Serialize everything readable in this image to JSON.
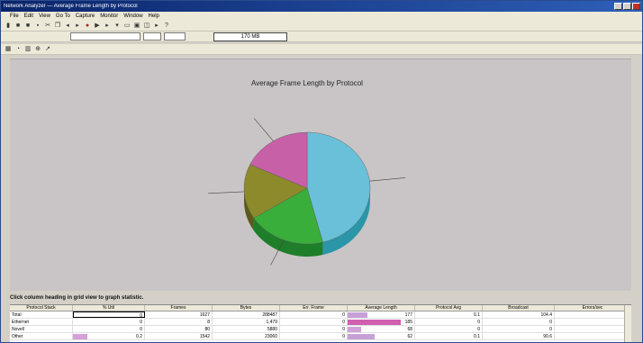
{
  "window": {
    "title": "Network Analyzer — Average Frame Length by Protocol"
  },
  "menu": [
    "File",
    "Edit",
    "View",
    "Go To",
    "Capture",
    "Monitor",
    "Window",
    "Help"
  ],
  "toolbar": {
    "status_value": "170 MB"
  },
  "chart_data": {
    "type": "pie",
    "title": "Average Frame Length by Protocol",
    "series": [
      {
        "name": "",
        "values": [
          46,
          20,
          16,
          18
        ]
      }
    ],
    "slices": [
      {
        "label": "",
        "value": 46,
        "color": "#6ac0d8",
        "side": "#2a96a8"
      },
      {
        "label": "",
        "value": 20,
        "color": "#3aae3a",
        "side": "#1e7e2a"
      },
      {
        "label": "",
        "value": 16,
        "color": "#8c8a2a",
        "side": "#5a5a1a"
      },
      {
        "label": "",
        "value": 18,
        "color": "#c860a8",
        "side": "#8c3c78"
      }
    ]
  },
  "hint_text": "Click column heading in grid view to graph statistic.",
  "grid": {
    "headers": [
      "Protocol Stack",
      "% Util",
      "Frames",
      "Bytes",
      "Err. Frame",
      "Average Length",
      "Protocol Avg",
      "Broadcast",
      "Errors/sec"
    ],
    "rows": [
      {
        "name": "Total",
        "cells": [
          "0",
          "1627",
          "288487",
          "0",
          "177",
          "0.1",
          "104.4",
          "0"
        ],
        "bar": 0,
        "avg_bar": 0.3,
        "avg_bar_color": "#c8a0d8"
      },
      {
        "name": "Ethernet",
        "cells": [
          "0",
          "8",
          "1,479",
          "0",
          "185",
          "0",
          "0",
          "0"
        ],
        "bar": 0,
        "avg_bar": 0.8,
        "avg_bar_color": "#d060b0"
      },
      {
        "name": "Novell",
        "cells": [
          "0",
          "80",
          "5880",
          "0",
          "68",
          "0",
          "0",
          "0"
        ],
        "bar": 0,
        "avg_bar": 0.2,
        "avg_bar_color": "#d0a0d8"
      },
      {
        "name": "Other",
        "cells": [
          "0.2",
          "1542",
          "23060",
          "0",
          "62",
          "0.1",
          "90.6",
          "0"
        ],
        "bar": 0.2,
        "avg_bar": 0.4,
        "avg_bar_color": "#c8a0d8"
      }
    ]
  }
}
